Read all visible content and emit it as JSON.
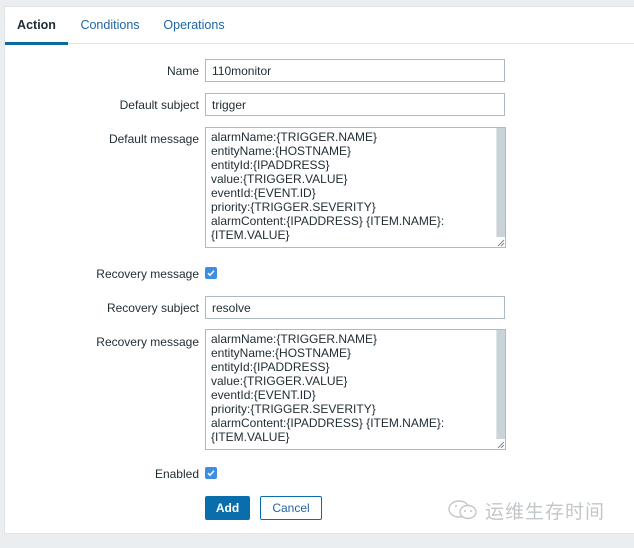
{
  "tabs": [
    {
      "label": "Action",
      "active": true
    },
    {
      "label": "Conditions",
      "active": false
    },
    {
      "label": "Operations",
      "active": false
    }
  ],
  "form": {
    "name": {
      "label": "Name",
      "value": "110monitor"
    },
    "default_subject": {
      "label": "Default subject",
      "value": "trigger"
    },
    "default_message": {
      "label": "Default message",
      "value": "alarmName:{TRIGGER.NAME}\nentityName:{HOSTNAME}\nentityId:{IPADDRESS}\nvalue:{TRIGGER.VALUE}\neventId:{EVENT.ID}\npriority:{TRIGGER.SEVERITY}\nalarmContent:{IPADDRESS} {ITEM.NAME}:\n{ITEM.VALUE}"
    },
    "recovery_message_toggle": {
      "label": "Recovery message",
      "checked": true
    },
    "recovery_subject": {
      "label": "Recovery subject",
      "value": "resolve"
    },
    "recovery_message": {
      "label": "Recovery message",
      "value": "alarmName:{TRIGGER.NAME}\nentityName:{HOSTNAME}\nentityId:{IPADDRESS}\nvalue:{TRIGGER.VALUE}\neventId:{EVENT.ID}\npriority:{TRIGGER.SEVERITY}\nalarmContent:{IPADDRESS} {ITEM.NAME}:\n{ITEM.VALUE}"
    },
    "enabled": {
      "label": "Enabled",
      "checked": true
    }
  },
  "buttons": {
    "add_label": "Add",
    "cancel_label": "Cancel"
  },
  "watermark": {
    "icon": "wechat-icon",
    "text": "运维生存时间"
  },
  "colors": {
    "accent": "#0a6ead",
    "tab_underline": "#0a6b9a",
    "link": "#1f65a6",
    "checkbox": "#3d8ee3",
    "page_background": "#ebeef0"
  }
}
